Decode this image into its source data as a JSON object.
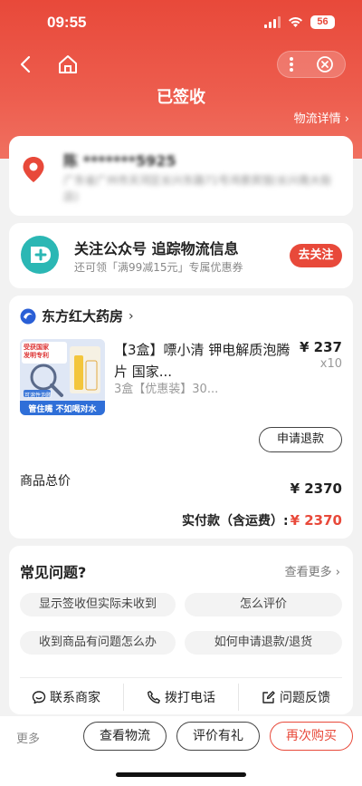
{
  "status": {
    "time": "09:55",
    "battery": "56"
  },
  "nav": {
    "title": "已签收",
    "logistics_link": "物流详情 ›"
  },
  "address": {
    "name": "陈 *******5925",
    "detail": "广东省广州市天河区长兴东路71号鸿景宾馆(长兴南大街店)"
  },
  "follow": {
    "title": "关注公众号 追踪物流信息",
    "subtitle": "还可领「满99减15元」专属优惠券",
    "button": "去关注"
  },
  "order": {
    "shop_name": "东方红大药房",
    "product": {
      "title": "【3盒】嘌小清 钾电解质泡腾片 国家...",
      "spec": "3盒【优惠装】30...",
      "price": "¥ 237",
      "qty": "x10",
      "image_texts": [
        "受获国家",
        "发明专利",
        "管住嘴 不如喝对水",
        "可溶性泡腾"
      ]
    },
    "refund_button": "申请退款",
    "total_label": "商品总价",
    "total_value": "¥ 2370",
    "paid_label": "实付款（含运费）:",
    "paid_value": "¥ 2370"
  },
  "faq": {
    "title": "常见问题?",
    "more": "查看更多 ›",
    "questions": [
      "显示签收但实际未收到",
      "怎么评价",
      "收到商品有问题怎么办",
      "如何申请退款/退货"
    ],
    "actions": [
      {
        "label": "联系商家",
        "icon": "chat-icon"
      },
      {
        "label": "拨打电话",
        "icon": "phone-icon"
      },
      {
        "label": "问题反馈",
        "icon": "edit-icon"
      }
    ]
  },
  "bottom": {
    "more": "更多",
    "buttons": [
      "查看物流",
      "评价有礼",
      "再次购买"
    ]
  },
  "colors": {
    "accent": "#e8493a",
    "follow_icon": "#2bb7b4",
    "shop_logo": "#2a5fd6"
  }
}
